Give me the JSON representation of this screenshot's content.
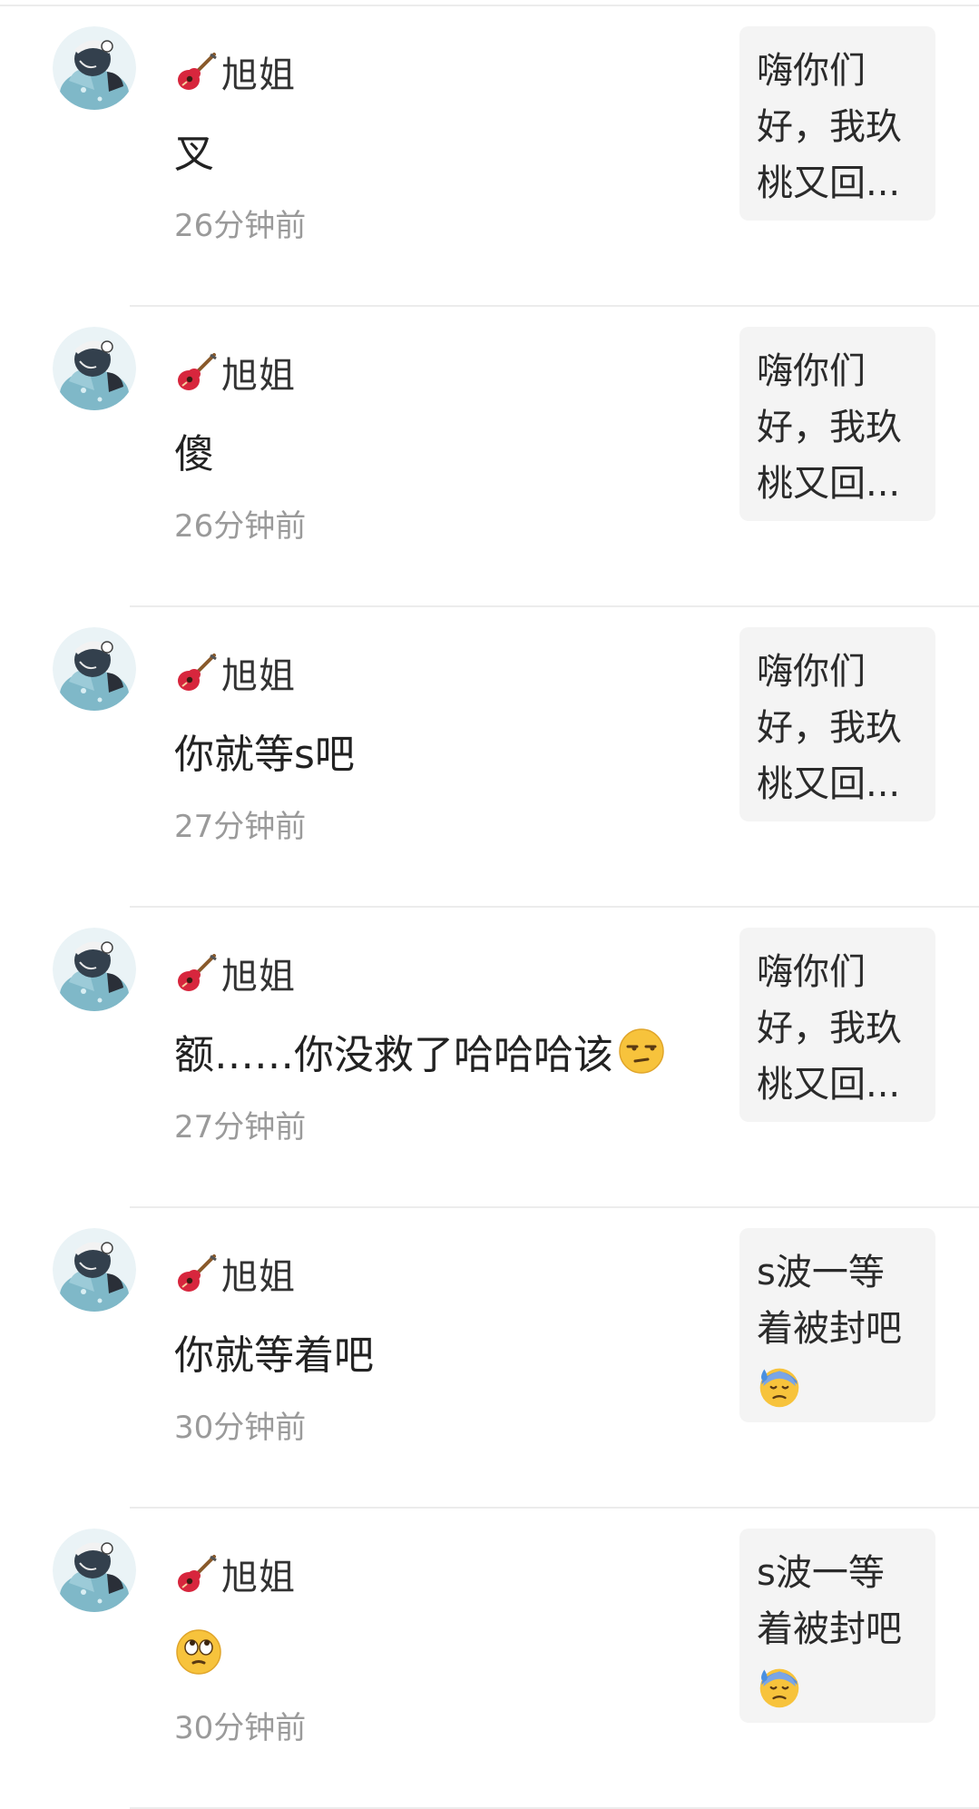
{
  "items": [
    {
      "name": "旭姐",
      "comment": "叉",
      "comment_emoji": "",
      "time": "26分钟前",
      "preview_lines": [
        "嗨你们",
        "好，我玖",
        "桃又回..."
      ],
      "preview_emoji": ""
    },
    {
      "name": "旭姐",
      "comment": "傻",
      "comment_emoji": "",
      "time": "26分钟前",
      "preview_lines": [
        "嗨你们",
        "好，我玖",
        "桃又回..."
      ],
      "preview_emoji": ""
    },
    {
      "name": "旭姐",
      "comment": "你就等s吧",
      "comment_emoji": "",
      "time": "27分钟前",
      "preview_lines": [
        "嗨你们",
        "好，我玖",
        "桃又回..."
      ],
      "preview_emoji": ""
    },
    {
      "name": "旭姐",
      "comment": "额……你没救了哈哈哈该",
      "comment_emoji": "unamused-face-icon",
      "time": "27分钟前",
      "preview_lines": [
        "嗨你们",
        "好，我玖",
        "桃又回..."
      ],
      "preview_emoji": ""
    },
    {
      "name": "旭姐",
      "comment": "你就等着吧",
      "comment_emoji": "",
      "time": "30分钟前",
      "preview_lines": [
        "s波一等",
        "着被封吧"
      ],
      "preview_emoji": "anxious-sweat-face-icon"
    },
    {
      "name": "旭姐",
      "comment": "",
      "comment_emoji": "eye-roll-face-icon",
      "time": "30分钟前",
      "preview_lines": [
        "s波一等",
        "着被封吧"
      ],
      "preview_emoji": "anxious-sweat-face-icon"
    }
  ],
  "icons": {
    "name_prefix": "guitar-icon"
  },
  "colors": {
    "divider": "#ececec",
    "time_text": "#9a9a9a",
    "preview_bg": "#f4f4f4",
    "avatar_tint": "#7fb8c8"
  }
}
